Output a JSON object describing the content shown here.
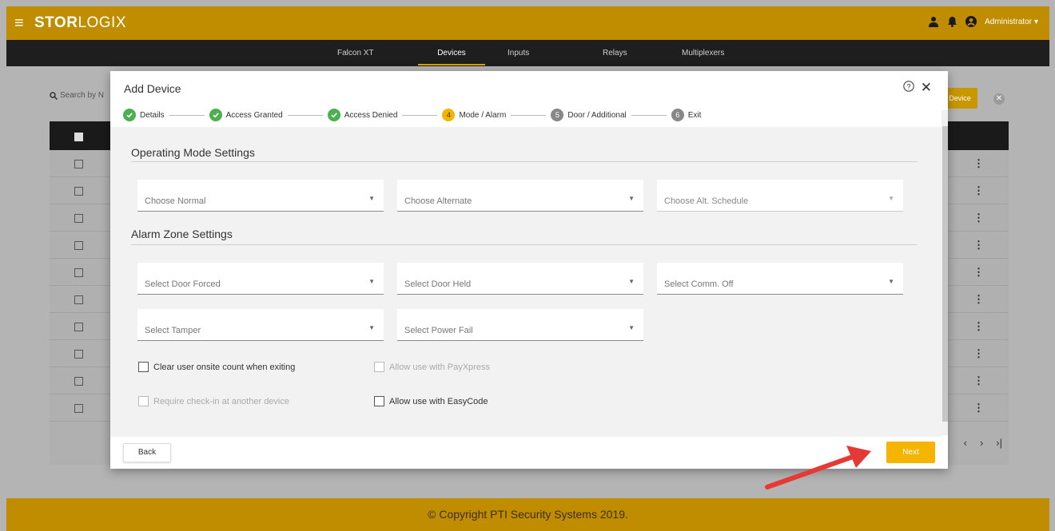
{
  "app": {
    "brand_bold": "STOR",
    "brand_light": "LOGIX",
    "user": "Administrator"
  },
  "nav": [
    "Falcon XT",
    "Devices",
    "Inputs",
    "Relays",
    "Multiplexers"
  ],
  "nav_active": "Devices",
  "background": {
    "search_placeholder": "Search by N",
    "add_button": "Device",
    "row_count": 10
  },
  "modal": {
    "title": "Add Device",
    "steps": [
      {
        "label": "Details",
        "state": "done",
        "num": ""
      },
      {
        "label": "Access Granted",
        "state": "done",
        "num": ""
      },
      {
        "label": "Access Denied",
        "state": "done",
        "num": ""
      },
      {
        "label": "Mode / Alarm",
        "state": "active",
        "num": "4"
      },
      {
        "label": "Door / Additional",
        "state": "pending",
        "num": "5"
      },
      {
        "label": "Exit",
        "state": "pending",
        "num": "6"
      }
    ],
    "operating_title": "Operating Mode Settings",
    "operating": {
      "normal": "Choose Normal",
      "alternate": "Choose Alternate",
      "alt_schedule": "Choose Alt. Schedule"
    },
    "alarm_title": "Alarm Zone Settings",
    "alarm": {
      "door_forced": "Select Door Forced",
      "door_held": "Select Door Held",
      "comm_off": "Select Comm. Off",
      "tamper": "Select Tamper",
      "power_fail": "Select Power Fail"
    },
    "checkboxes": {
      "clear_onsite": "Clear user onsite count when exiting",
      "payxpress": "Allow use with PayXpress",
      "require_checkin": "Require check-in at another device",
      "easycode": "Allow use with EasyCode"
    },
    "back": "Back",
    "next": "Next"
  },
  "footer": "© Copyright PTI Security Systems 2019.",
  "colors": {
    "brand": "#c08d00",
    "accent": "#f4b400",
    "done": "#4caf50"
  }
}
